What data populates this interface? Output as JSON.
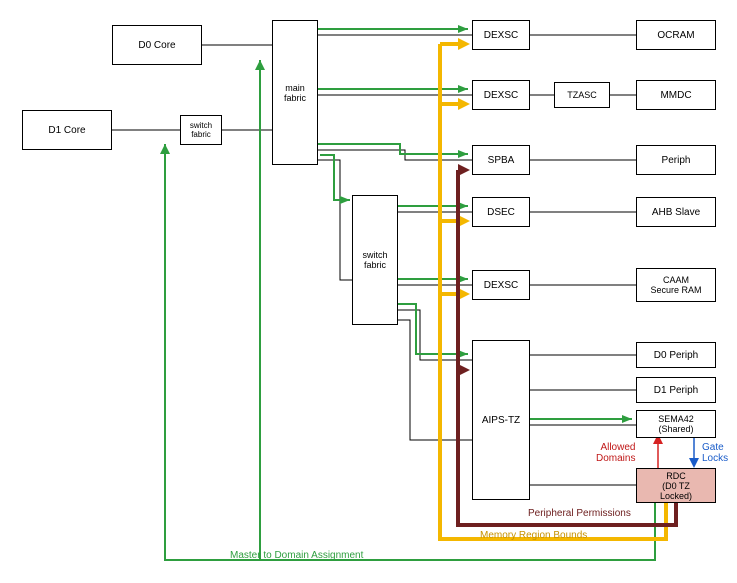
{
  "blocks": {
    "d0_core": "D0 Core",
    "d1_core": "D1 Core",
    "switch_fabric_1": "switch\nfabric",
    "main_fabric": "main\nfabric",
    "switch_fabric_2": "switch\nfabric",
    "dexsc_1": "DEXSC",
    "dexsc_2": "DEXSC",
    "spba": "SPBA",
    "dsec": "DSEC",
    "dexsc_3": "DEXSC",
    "aips_tz": "AIPS-TZ",
    "tzasc": "TZASC",
    "ocram": "OCRAM",
    "mmdc": "MMDC",
    "periph": "Periph",
    "ahb_slave": "AHB Slave",
    "caam": "CAAM\nSecure RAM",
    "d0_periph": "D0 Periph",
    "d1_periph": "D1 Periph",
    "sema42": "SEMA42\n(Shared)",
    "rdc": "RDC\n(D0 TZ\nLocked)"
  },
  "labels": {
    "allowed_domains": "Allowed\nDomains",
    "gate_locks": "Gate\nLocks",
    "peripheral_permissions": "Peripheral Permissions",
    "memory_region_bounds": "Memory Region Bounds",
    "master_to_domain": "Master to Domain Assignment"
  }
}
